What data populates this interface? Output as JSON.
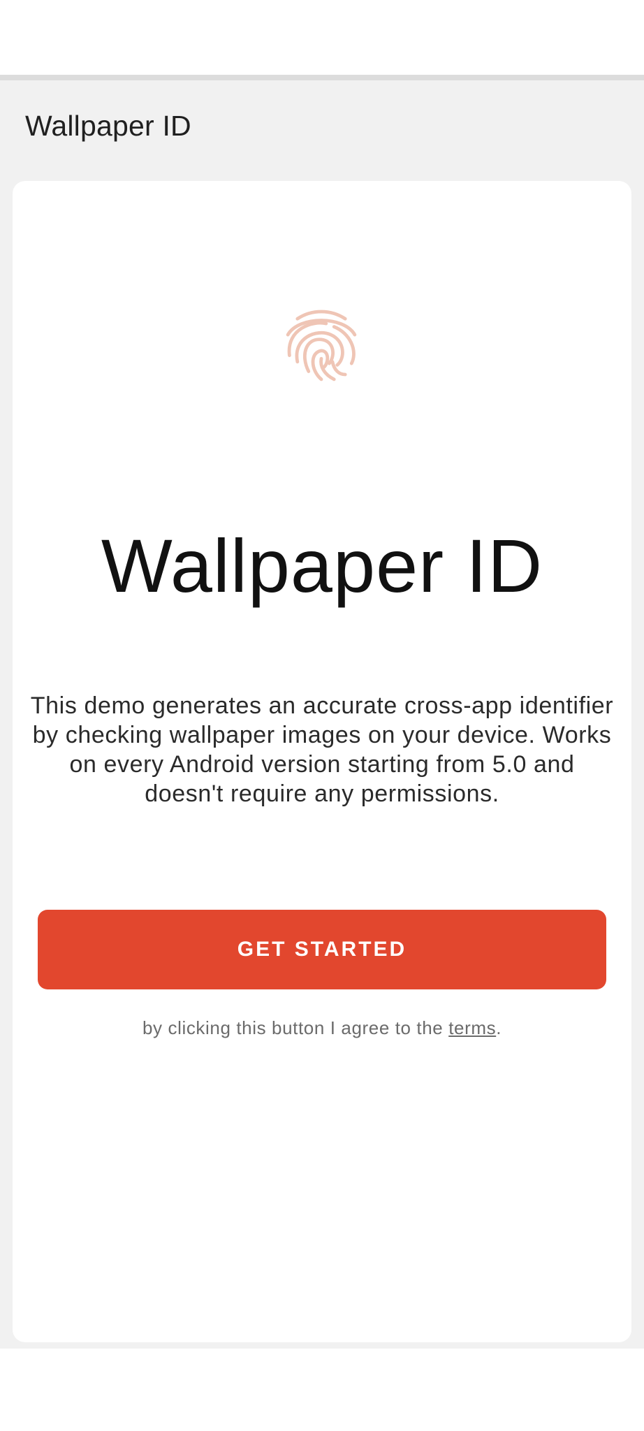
{
  "app_bar": {
    "title": "Wallpaper ID"
  },
  "hero": {
    "icon": "fingerprint-icon",
    "icon_color": "#efc5b5",
    "title": "Wallpaper ID"
  },
  "description": "This demo generates an accurate cross-app identifier by checking wallpaper images on your device. Works on every Android version starting from 5.0 and doesn't require any permissions.",
  "cta": {
    "label": "GET STARTED",
    "color": "#e2472e"
  },
  "terms": {
    "prefix": "by clicking this button I agree to the ",
    "link_label": "terms",
    "suffix": "."
  }
}
